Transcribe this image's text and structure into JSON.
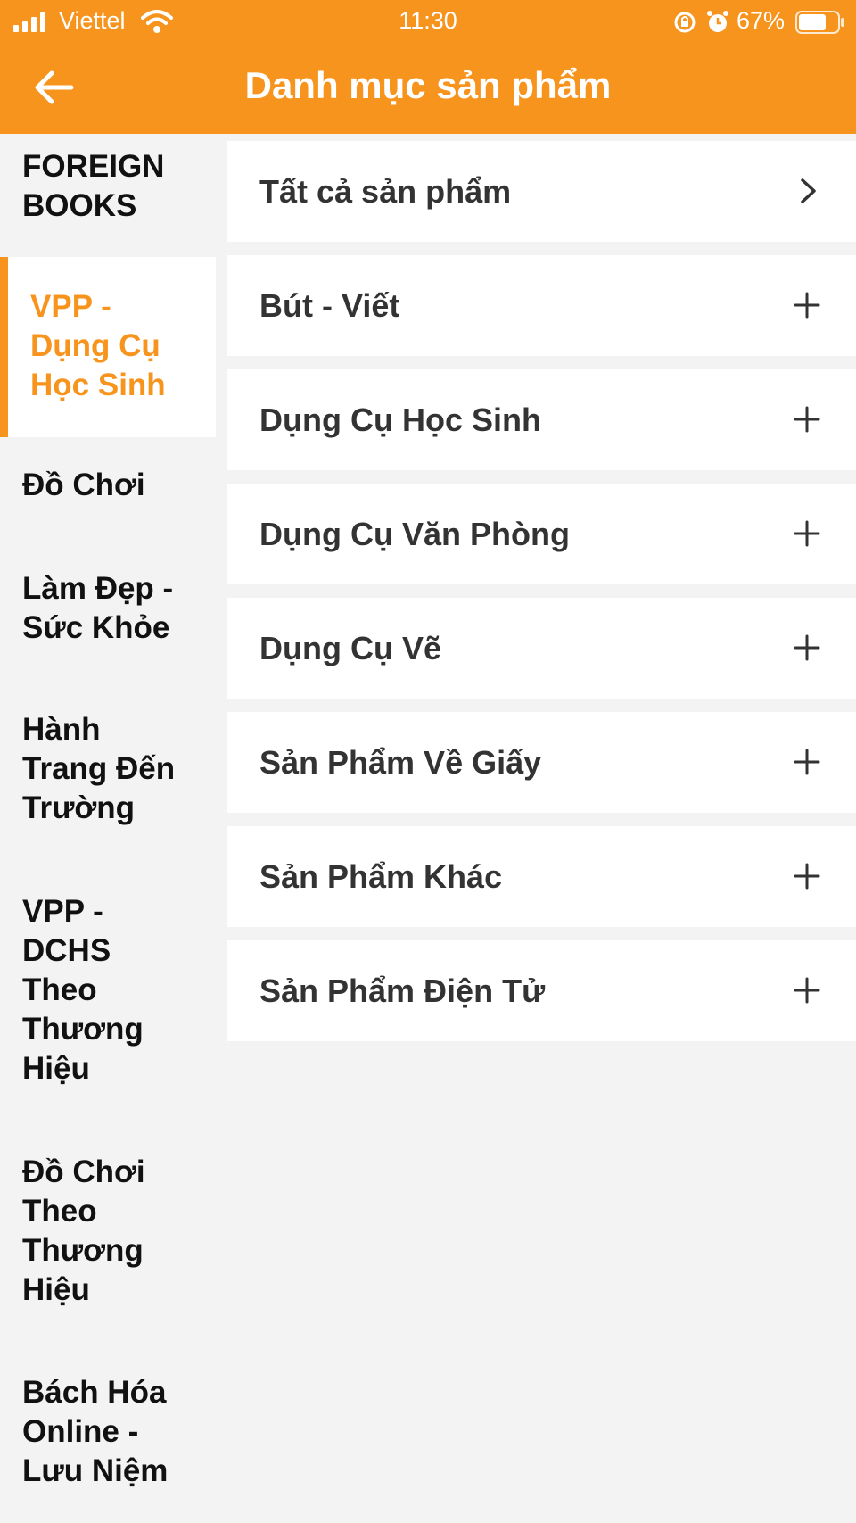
{
  "status_bar": {
    "carrier": "Viettel",
    "time": "11:30",
    "battery": "67%"
  },
  "header": {
    "title": "Danh mục sản phẩm"
  },
  "sidebar": {
    "items": [
      {
        "label": "FOREIGN\nBOOKS"
      },
      {
        "label": "VPP -\nDụng Cụ\nHọc Sinh"
      },
      {
        "label": "Đồ Chơi"
      },
      {
        "label": "Làm Đẹp -\nSức Khỏe"
      },
      {
        "label": "Hành\nTrang Đến\nTrường"
      },
      {
        "label": "VPP -\nDCHS\nTheo\nThương\nHiệu"
      },
      {
        "label": "Đồ Chơi\nTheo\nThương\nHiệu"
      },
      {
        "label": "Bách Hóa\nOnline -\nLưu Niệm"
      }
    ],
    "active_index": 1
  },
  "categories": [
    {
      "label": "Tất cả sản phẩm",
      "icon": "chevron-right-icon"
    },
    {
      "label": "Bút - Viết",
      "icon": "plus-icon"
    },
    {
      "label": "Dụng Cụ Học Sinh",
      "icon": "plus-icon"
    },
    {
      "label": "Dụng Cụ Văn Phòng",
      "icon": "plus-icon"
    },
    {
      "label": "Dụng Cụ Vẽ",
      "icon": "plus-icon"
    },
    {
      "label": "Sản Phẩm Về Giấy",
      "icon": "plus-icon"
    },
    {
      "label": "Sản Phẩm Khác",
      "icon": "plus-icon"
    },
    {
      "label": "Sản Phẩm Điện Tử",
      "icon": "plus-icon"
    }
  ],
  "colors": {
    "accent": "#f7941d",
    "background": "#f3f3f3",
    "row_background": "#ffffff",
    "text": "#333333"
  }
}
